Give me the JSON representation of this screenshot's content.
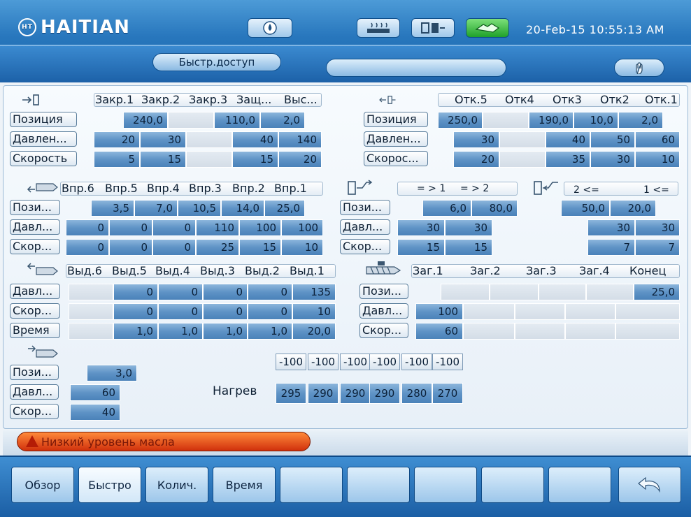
{
  "header": {
    "brand": "HAITIAN",
    "brand_mark": "HT",
    "datetime": "20-Feb-15 10:55:13 AM",
    "quick_access": "Быстр.доступ"
  },
  "clamp_close": {
    "headers": [
      "Закр.1",
      "Закр.2",
      "Закр.3",
      "Защ...",
      "Выс..."
    ],
    "rows": [
      {
        "label": "Позиция",
        "values": [
          "240,0",
          "",
          "110,0",
          "2,0"
        ]
      },
      {
        "label": "Давлен...",
        "values": [
          "20",
          "30",
          "",
          "40",
          "140"
        ]
      },
      {
        "label": "Скорость",
        "values": [
          "5",
          "15",
          "",
          "15",
          "20"
        ]
      }
    ]
  },
  "clamp_open": {
    "headers": [
      "Отк.5",
      "Отк4",
      "Отк3",
      "Отк2",
      "Отк.1"
    ],
    "rows": [
      {
        "label": "Позиция",
        "values": [
          "250,0",
          "",
          "190,0",
          "10,0",
          "2,0"
        ]
      },
      {
        "label": "Давлен...",
        "values": [
          "30",
          "",
          "40",
          "50",
          "60"
        ]
      },
      {
        "label": "Скорос...",
        "values": [
          "20",
          "",
          "35",
          "30",
          "10"
        ]
      }
    ]
  },
  "injection": {
    "headers": [
      "Впр.6",
      "Впр.5",
      "Впр.4",
      "Впр.3",
      "Впр.2",
      "Впр.1"
    ],
    "rows": [
      {
        "label": "Пози...",
        "values": [
          "3,5",
          "7,0",
          "10,5",
          "14,0",
          "25,0"
        ]
      },
      {
        "label": "Давл...",
        "values": [
          "0",
          "0",
          "0",
          "110",
          "100",
          "100"
        ]
      },
      {
        "label": "Скор...",
        "values": [
          "0",
          "0",
          "0",
          "25",
          "15",
          "10"
        ]
      }
    ]
  },
  "ejector_fwd": {
    "headers": [
      "= > 1",
      "= > 2"
    ],
    "rows": [
      {
        "label": "Пози...",
        "values": [
          "6,0",
          "80,0"
        ]
      },
      {
        "label": "Давл...",
        "values": [
          "30",
          "30"
        ]
      },
      {
        "label": "Скор...",
        "values": [
          "15",
          "15"
        ]
      }
    ]
  },
  "ejector_back": {
    "headers": [
      "2 <=",
      "1 <="
    ],
    "rows": [
      {
        "values": [
          "50,0",
          "20,0"
        ]
      },
      {
        "values": [
          "30",
          "30"
        ]
      },
      {
        "values": [
          "7",
          "7"
        ]
      }
    ]
  },
  "hold": {
    "headers": [
      "Выд.6",
      "Выд.5",
      "Выд.4",
      "Выд.3",
      "Выд.2",
      "Выд.1"
    ],
    "rows": [
      {
        "label": "Давл...",
        "values": [
          "",
          "0",
          "0",
          "0",
          "0",
          "135"
        ]
      },
      {
        "label": "Скор...",
        "values": [
          "",
          "0",
          "0",
          "0",
          "0",
          "10"
        ]
      },
      {
        "label": "Время",
        "values": [
          "",
          "1,0",
          "1,0",
          "1,0",
          "1,0",
          "20,0"
        ]
      }
    ]
  },
  "charge": {
    "headers": [
      "Заг.1",
      "Заг.2",
      "Заг.3",
      "Заг.4",
      "Конец"
    ],
    "rows": [
      {
        "label": "Пози...",
        "values": [
          "",
          "",
          "",
          "",
          "25,0"
        ]
      },
      {
        "label": "Давл...",
        "values": [
          "100"
        ]
      },
      {
        "label": "Скор...",
        "values": [
          "60"
        ]
      }
    ]
  },
  "suckback": {
    "rows": [
      {
        "label": "Пози...",
        "value": "3,0"
      },
      {
        "label": "Давл...",
        "value": "60"
      },
      {
        "label": "Скор...",
        "value": "40"
      }
    ]
  },
  "heating": {
    "label": "Нагрев",
    "offsets": [
      "-100",
      "-100",
      "-100",
      "-100",
      "-100",
      "-100"
    ],
    "temps": [
      "295",
      "290",
      "290",
      "290",
      "280",
      "270"
    ]
  },
  "alarm": {
    "text": "Низкий уровень масла",
    "color": "#d0300c"
  },
  "footer": {
    "buttons": [
      "Обзор",
      "Быстро",
      "Колич.",
      "Время",
      "",
      "",
      "",
      "",
      ""
    ]
  }
}
